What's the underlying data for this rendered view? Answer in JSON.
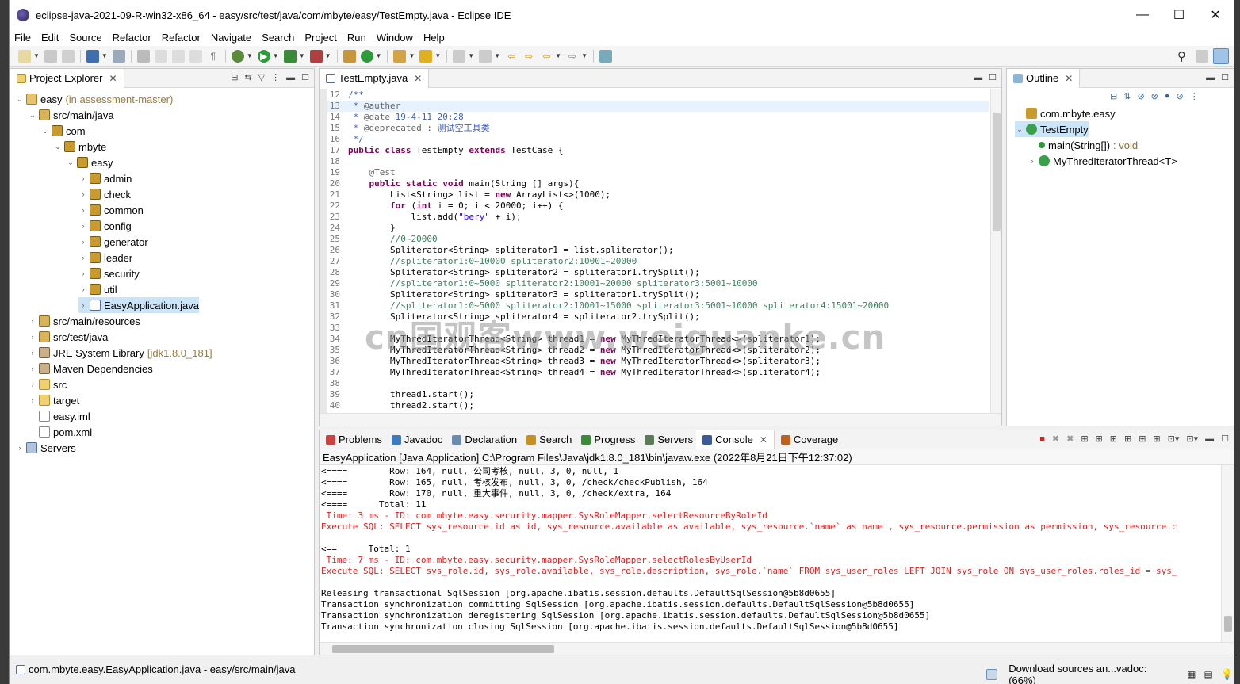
{
  "window": {
    "title": "eclipse-java-2021-09-R-win32-x86_64 - easy/src/test/java/com/mbyte/easy/TestEmpty.java - Eclipse IDE",
    "minimize": "—",
    "maximize": "☐",
    "close": "✕"
  },
  "menu": [
    "File",
    "Edit",
    "Source",
    "Refactor",
    "Refactor",
    "Navigate",
    "Search",
    "Project",
    "Run",
    "Window",
    "Help"
  ],
  "explorer": {
    "tab_label": "Project Explorer",
    "tree": [
      {
        "label": "easy",
        "suffix": "(in assessment-master)",
        "depth": 0,
        "twisty": "⌄",
        "icon": "proj"
      },
      {
        "label": "src/main/java",
        "depth": 1,
        "twisty": "⌄",
        "icon": "src"
      },
      {
        "label": "com",
        "depth": 2,
        "twisty": "⌄",
        "icon": "pkg"
      },
      {
        "label": "mbyte",
        "depth": 3,
        "twisty": "⌄",
        "icon": "pkg"
      },
      {
        "label": "easy",
        "depth": 4,
        "twisty": "⌄",
        "icon": "pkg"
      },
      {
        "label": "admin",
        "depth": 5,
        "twisty": "›",
        "icon": "pkg"
      },
      {
        "label": "check",
        "depth": 5,
        "twisty": "›",
        "icon": "pkg"
      },
      {
        "label": "common",
        "depth": 5,
        "twisty": "›",
        "icon": "pkg"
      },
      {
        "label": "config",
        "depth": 5,
        "twisty": "›",
        "icon": "pkg"
      },
      {
        "label": "generator",
        "depth": 5,
        "twisty": "›",
        "icon": "pkg"
      },
      {
        "label": "leader",
        "depth": 5,
        "twisty": "›",
        "icon": "pkg"
      },
      {
        "label": "security",
        "depth": 5,
        "twisty": "›",
        "icon": "pkg"
      },
      {
        "label": "util",
        "depth": 5,
        "twisty": "›",
        "icon": "pkg"
      },
      {
        "label": "EasyApplication.java",
        "depth": 5,
        "twisty": "›",
        "icon": "java",
        "selected": true
      },
      {
        "label": "src/main/resources",
        "depth": 1,
        "twisty": "›",
        "icon": "src"
      },
      {
        "label": "src/test/java",
        "depth": 1,
        "twisty": "›",
        "icon": "src"
      },
      {
        "label": "JRE System Library",
        "suffix": "[jdk1.8.0_181]",
        "depth": 1,
        "twisty": "›",
        "icon": "lib"
      },
      {
        "label": "Maven Dependencies",
        "depth": 1,
        "twisty": "›",
        "icon": "lib"
      },
      {
        "label": "src",
        "depth": 1,
        "twisty": "›",
        "icon": "folder"
      },
      {
        "label": "target",
        "depth": 1,
        "twisty": "›",
        "icon": "folder"
      },
      {
        "label": "easy.iml",
        "depth": 1,
        "twisty": "",
        "icon": "file"
      },
      {
        "label": "pom.xml",
        "depth": 1,
        "twisty": "",
        "icon": "file"
      },
      {
        "label": "Servers",
        "depth": 0,
        "twisty": "›",
        "icon": "server"
      }
    ]
  },
  "editor": {
    "tab_label": "TestEmpty.java",
    "lines": [
      {
        "n": "12",
        "parts": [
          [
            "c-doc",
            "/**"
          ]
        ]
      },
      {
        "n": "13",
        "hl": true,
        "parts": [
          [
            "c-doc",
            " * "
          ],
          [
            "c-ann",
            "@auther"
          ]
        ]
      },
      {
        "n": "14",
        "parts": [
          [
            "c-doc",
            " * "
          ],
          [
            "c-ann",
            "@date"
          ],
          [
            "c-doc",
            " 19-4-11 20:28"
          ]
        ]
      },
      {
        "n": "15",
        "parts": [
          [
            "c-doc",
            " * "
          ],
          [
            "c-ann",
            "@deprecated"
          ],
          [
            "c-doc",
            " : 测试空工具类"
          ]
        ]
      },
      {
        "n": "16",
        "parts": [
          [
            "c-doc",
            " */"
          ]
        ]
      },
      {
        "n": "17",
        "parts": [
          [
            "c-kw",
            "public class "
          ],
          [
            "",
            "TestEmpty "
          ],
          [
            "c-kw",
            "extends "
          ],
          [
            "",
            "TestCase {"
          ]
        ]
      },
      {
        "n": "18",
        "parts": [
          [
            "",
            ""
          ]
        ]
      },
      {
        "n": "19",
        "parts": [
          [
            "c-ann",
            "    @Test"
          ]
        ]
      },
      {
        "n": "20",
        "parts": [
          [
            "c-kw",
            "    public static void "
          ],
          [
            "",
            "main(String [] args){"
          ]
        ]
      },
      {
        "n": "21",
        "parts": [
          [
            "",
            "        List<String> list = "
          ],
          [
            "c-kw",
            "new "
          ],
          [
            "",
            "ArrayList<>(1000);"
          ]
        ]
      },
      {
        "n": "22",
        "parts": [
          [
            "c-kw",
            "        for "
          ],
          [
            "",
            "("
          ],
          [
            "c-kw",
            "int "
          ],
          [
            "",
            "i = 0; i < 20000; i++) {"
          ]
        ]
      },
      {
        "n": "23",
        "parts": [
          [
            "",
            "            list.add("
          ],
          [
            "c-str",
            "\"bery\""
          ],
          [
            "",
            " + i);"
          ]
        ]
      },
      {
        "n": "24",
        "parts": [
          [
            "",
            "        }"
          ]
        ]
      },
      {
        "n": "25",
        "parts": [
          [
            "c-cmt",
            "        //0~20000"
          ]
        ]
      },
      {
        "n": "26",
        "parts": [
          [
            "",
            "        Spliterator<String> spliterator1 = list.spliterator();"
          ]
        ]
      },
      {
        "n": "27",
        "parts": [
          [
            "c-cmt",
            "        //spliterator1:0~10000 spliterator2:10001~20000"
          ]
        ]
      },
      {
        "n": "28",
        "parts": [
          [
            "",
            "        Spliterator<String> spliterator2 = spliterator1.trySplit();"
          ]
        ]
      },
      {
        "n": "29",
        "parts": [
          [
            "c-cmt",
            "        //spliterator1:0~5000 spliterator2:10001~20000 spliterator3:5001~10000"
          ]
        ]
      },
      {
        "n": "30",
        "parts": [
          [
            "",
            "        Spliterator<String> spliterator3 = spliterator1.trySplit();"
          ]
        ]
      },
      {
        "n": "31",
        "parts": [
          [
            "c-cmt",
            "        //spliterator1:0~5000 spliterator2:10001~15000 spliterator3:5001~10000 spliterator4:15001~20000"
          ]
        ]
      },
      {
        "n": "32",
        "parts": [
          [
            "",
            "        Spliterator<String> spliterator4 = spliterator2.trySplit();"
          ]
        ]
      },
      {
        "n": "33",
        "parts": [
          [
            "",
            ""
          ]
        ]
      },
      {
        "n": "34",
        "parts": [
          [
            "",
            "        MyThredIteratorThread<String> thread1 = "
          ],
          [
            "c-kw",
            "new "
          ],
          [
            "",
            "MyThredIteratorThread<>(spliterator1);"
          ]
        ]
      },
      {
        "n": "35",
        "parts": [
          [
            "",
            "        MyThredIteratorThread<String> thread2 = "
          ],
          [
            "c-kw",
            "new "
          ],
          [
            "",
            "MyThredIteratorThread<>(spliterator2);"
          ]
        ]
      },
      {
        "n": "36",
        "parts": [
          [
            "",
            "        MyThredIteratorThread<String> thread3 = "
          ],
          [
            "c-kw",
            "new "
          ],
          [
            "",
            "MyThredIteratorThread<>(spliterator3);"
          ]
        ]
      },
      {
        "n": "37",
        "parts": [
          [
            "",
            "        MyThredIteratorThread<String> thread4 = "
          ],
          [
            "c-kw",
            "new "
          ],
          [
            "",
            "MyThredIteratorThread<>(spliterator4);"
          ]
        ]
      },
      {
        "n": "38",
        "parts": [
          [
            "",
            ""
          ]
        ]
      },
      {
        "n": "39",
        "parts": [
          [
            "",
            "        thread1.start();"
          ]
        ]
      },
      {
        "n": "40",
        "parts": [
          [
            "",
            "        thread2.start();"
          ]
        ]
      }
    ]
  },
  "outline": {
    "tab_label": "Outline",
    "items": [
      {
        "label": "com.mbyte.easy",
        "depth": 0,
        "twisty": ""
      },
      {
        "label": "TestEmpty",
        "depth": 0,
        "twisty": "⌄",
        "selected": true
      },
      {
        "label": "main(String[])",
        "suffix": ": void",
        "depth": 1,
        "twisty": ""
      },
      {
        "label": "MyThredIteratorThread<T>",
        "depth": 1,
        "twisty": "›"
      }
    ]
  },
  "bottom": {
    "tabs": [
      "Problems",
      "Javadoc",
      "Declaration",
      "Search",
      "Progress",
      "Servers",
      "Console",
      "Coverage"
    ],
    "active_tab": "Console",
    "description": "EasyApplication [Java Application] C:\\Program Files\\Java\\jdk1.8.0_181\\bin\\javaw.exe  (2022年8月21日下午12:37:02)",
    "lines": [
      {
        "t": "<====        Row: 164, null, 公司考核, null, 3, 0, null, 1",
        "red": false
      },
      {
        "t": "<====        Row: 165, null, 考核发布, null, 3, 0, /check/checkPublish, 164",
        "red": false
      },
      {
        "t": "<====        Row: 170, null, 重大事件, null, 3, 0, /check/extra, 164",
        "red": false
      },
      {
        "t": "<====      Total: 11",
        "red": false
      },
      {
        "t": " Time: 3 ms - ID: com.mbyte.easy.security.mapper.SysRoleMapper.selectResourceByRoleId",
        "red": true
      },
      {
        "t": "Execute SQL: SELECT sys_resource.id as id, sys_resource.available as available, sys_resource.`name` as name , sys_resource.permission as permission, sys_resource.c",
        "red": true
      },
      {
        "t": "",
        "red": false
      },
      {
        "t": "<==      Total: 1",
        "red": false
      },
      {
        "t": " Time: 7 ms - ID: com.mbyte.easy.security.mapper.SysRoleMapper.selectRolesByUserId",
        "red": true
      },
      {
        "t": "Execute SQL: SELECT sys_role.id, sys_role.available, sys_role.description, sys_role.`name` FROM sys_user_roles LEFT JOIN sys_role ON sys_user_roles.roles_id = sys_",
        "red": true
      },
      {
        "t": "",
        "red": false
      },
      {
        "t": "Releasing transactional SqlSession [org.apache.ibatis.session.defaults.DefaultSqlSession@5b8d0655]",
        "red": false
      },
      {
        "t": "Transaction synchronization committing SqlSession [org.apache.ibatis.session.defaults.DefaultSqlSession@5b8d0655]",
        "red": false
      },
      {
        "t": "Transaction synchronization deregistering SqlSession [org.apache.ibatis.session.defaults.DefaultSqlSession@5b8d0655]",
        "red": false
      },
      {
        "t": "Transaction synchronization closing SqlSession [org.apache.ibatis.session.defaults.DefaultSqlSession@5b8d0655]",
        "red": false
      }
    ]
  },
  "status": {
    "left": "com.mbyte.easy.EasyApplication.java - easy/src/main/java",
    "right": "Download sources an...vadoc: (66%)"
  },
  "watermark": "cn国观客www.weiguanke.cn",
  "colors": {
    "keyword": "#7f0055",
    "comment": "#3f7f5f",
    "javadoc": "#3f5fbf",
    "string": "#2a00ff",
    "console_error": "#e02020"
  }
}
